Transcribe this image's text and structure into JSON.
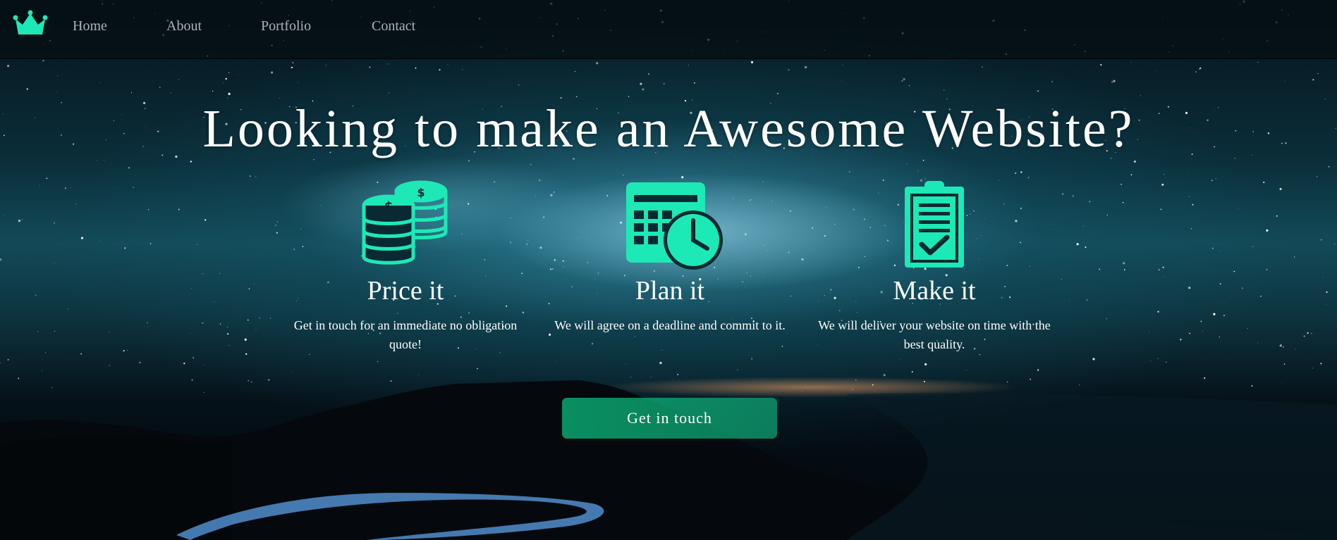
{
  "nav": {
    "logo_icon": "crown-icon",
    "links": [
      {
        "label": "Home"
      },
      {
        "label": "About"
      },
      {
        "label": "Portfolio"
      },
      {
        "label": "Contact"
      }
    ]
  },
  "hero": {
    "headline": "Looking to make an Awesome Website?",
    "features": [
      {
        "icon": "coins-icon",
        "title": "Price it",
        "text": "Get in touch for an immediate no obligation quote!"
      },
      {
        "icon": "calendar-clock-icon",
        "title": "Plan it",
        "text": "We will agree on a deadline and commit to it."
      },
      {
        "icon": "clipboard-check-icon",
        "title": "Make it",
        "text": "We will deliver your website on time with the best quality."
      }
    ],
    "cta_label": "Get in touch"
  },
  "colors": {
    "accent": "#1de9b6",
    "button": "#0aa878",
    "nav_text": "#a9b3b7",
    "text": "#ffffff"
  }
}
